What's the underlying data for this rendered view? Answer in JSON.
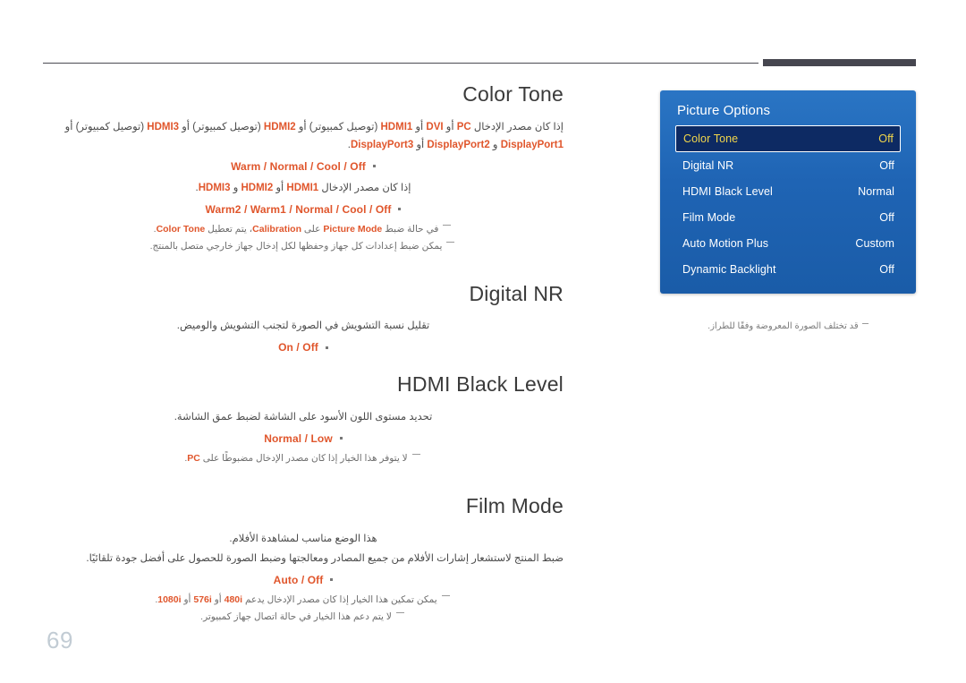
{
  "page": {
    "number": "69"
  },
  "header": {
    "rule_color": "#4b4b53",
    "bar_color": "#46464f"
  },
  "colors": {
    "accent_orange": "#e0562c",
    "heading_gray": "#3a3a3a",
    "osd_blue": "#1f64b4",
    "osd_selected_bg": "#0d2a63",
    "osd_selected_text": "#f2d64b",
    "page_number": "#c2ccd4"
  },
  "sections": [
    {
      "id": "color-tone",
      "title": "Color Tone",
      "desc1_html": "إذا كان مصدر الإدخال <b class=\"kw\">PC</b> أو <b class=\"kw\">DVI</b> أو <b class=\"kw\">HDMI1</b> (توصيل كمبيوتر) أو <b class=\"kw\">HDMI2</b> (توصيل كمبيوتر) أو <b class=\"kw\">HDMI3</b> (توصيل كمبيوتر) أو <b class=\"kw\">DisplayPort1</b> و <b class=\"kw\">DisplayPort2</b> أو <b class=\"kw\">DisplayPort3</b>.",
      "options1": "Warm / Normal / Cool / Off",
      "desc2_html": "إذا كان مصدر الإدخال <b class=\"kw\">HDMI1</b> أو <b class=\"kw\">HDMI2</b> و <b class=\"kw\">HDMI3</b>.",
      "options2": "Warm2 / Warm1 / Normal / Cool / Off",
      "note1_html": "في حالة ضبط <b class=\"kw\">Picture Mode</b> على <b class=\"kw\">Calibration</b>، يتم تعطيل <b class=\"kw\">Color Tone</b>.",
      "note2_html": "يمكن ضبط إعدادات كل جهاز وحفظها لكل إدخال جهاز خارجي متصل بالمنتج."
    },
    {
      "id": "digital-nr",
      "title": "Digital NR",
      "desc1_html": "تقليل نسبة التشويش في الصورة لتجنب التشويش والوميض.",
      "options1": "On / Off"
    },
    {
      "id": "hdmi-black-level",
      "title": "HDMI Black Level",
      "desc1_html": "تحديد مستوى اللون الأسود على الشاشة لضبط عمق الشاشة.",
      "options1": "Normal / Low",
      "note1_html": "لا يتوفر هذا الخيار إذا كان مصدر الإدخال مضبوطًا على <b class=\"kw\">PC</b>."
    },
    {
      "id": "film-mode",
      "title": "Film Mode",
      "desc1_html": "هذا الوضع مناسب لمشاهدة الأفلام.",
      "desc2_html": "ضبط المنتج لاستشعار إشارات الأفلام من جميع المصادر ومعالجتها وضبط الصورة للحصول على أفضل جودة تلقائيًا.",
      "options1": "Auto / Off",
      "note1_html": "يمكن تمكين هذا الخيار إذا كان مصدر الإدخال يدعم <b class=\"kw\">480i</b> أو <b class=\"kw\">576i</b> أو <b class=\"kw\">1080i</b>.",
      "note2_html": "لا يتم دعم هذا الخيار في حالة اتصال جهاز كمبيوتر."
    }
  ],
  "osd": {
    "title": "Picture Options",
    "rows": [
      {
        "label": "Color Tone",
        "value": "Off",
        "selected": true
      },
      {
        "label": "Digital NR",
        "value": "Off",
        "selected": false
      },
      {
        "label": "HDMI Black Level",
        "value": "Normal",
        "selected": false
      },
      {
        "label": "Film Mode",
        "value": "Off",
        "selected": false
      },
      {
        "label": "Auto Motion Plus",
        "value": "Custom",
        "selected": false
      },
      {
        "label": "Dynamic Backlight",
        "value": "Off",
        "selected": false
      }
    ],
    "note_html": "قد تختلف الصورة المعروضة وفقًا للطراز."
  }
}
